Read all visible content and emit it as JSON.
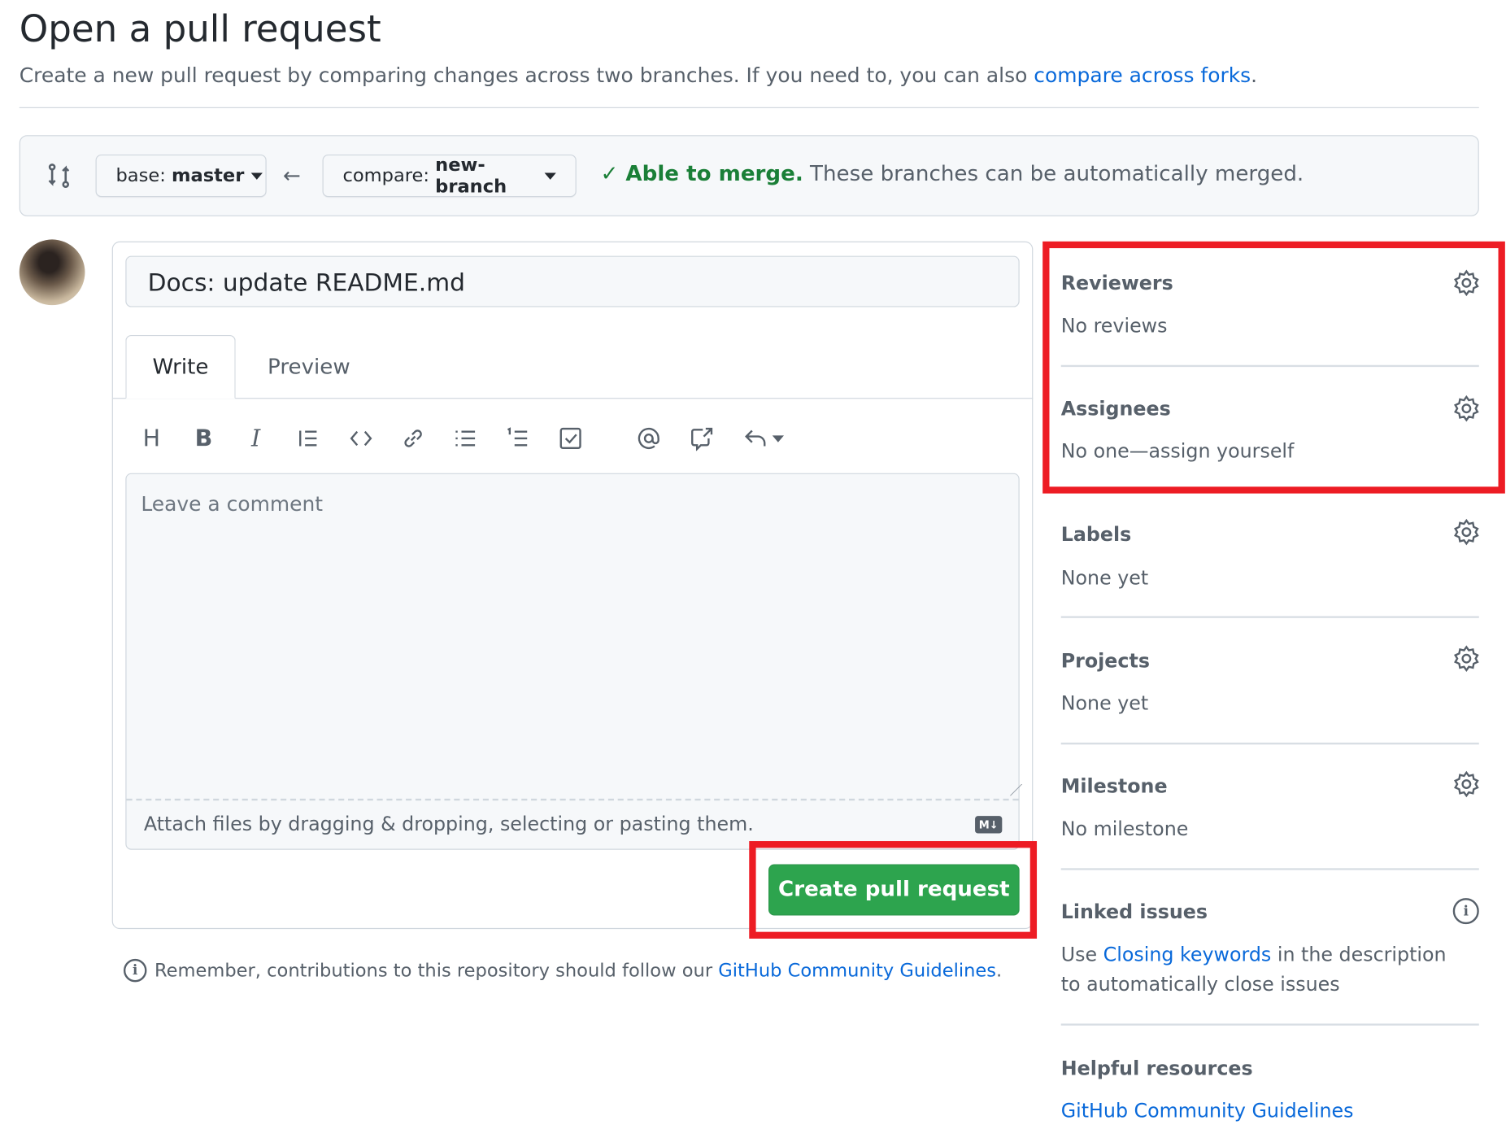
{
  "page": {
    "title": "Open a pull request",
    "subtitle": "Create a new pull request by comparing changes across two branches. If you need to, you can also ",
    "subtitle_link": "compare across forks",
    "subtitle_end": "."
  },
  "range": {
    "base_label": "base:",
    "base_value": "master",
    "compare_label": "compare:",
    "compare_value": "new-branch",
    "merge_status": "Able to merge.",
    "merge_message": " These branches can be automatically merged."
  },
  "form": {
    "title_value": "Docs: update README.md",
    "tabs": [
      {
        "label": "Write",
        "active": true
      },
      {
        "label": "Preview",
        "active": false
      }
    ],
    "toolbar": [
      "heading-icon",
      "bold-icon",
      "italic-icon",
      "quote-icon",
      "code-icon",
      "link-icon",
      "bulleted-list-icon",
      "numbered-list-icon",
      "task-list-icon",
      "mention-icon",
      "reference-icon",
      "reply-icon"
    ],
    "comment_placeholder": "Leave a comment",
    "attach_text": "Attach files by dragging & dropping, selecting or pasting them.",
    "markdown_badge": "M↓",
    "submit_label": "Create pull request"
  },
  "footer": {
    "remember_text": "Remember, contributions to this repository should follow our ",
    "remember_link": "GitHub Community Guidelines",
    "remember_end": "."
  },
  "sidebar": {
    "reviewers": {
      "title": "Reviewers",
      "value": "No reviews"
    },
    "assignees": {
      "title": "Assignees",
      "value": "No one—assign yourself"
    },
    "labels": {
      "title": "Labels",
      "value": "None yet"
    },
    "projects": {
      "title": "Projects",
      "value": "None yet"
    },
    "milestone": {
      "title": "Milestone",
      "value": "No milestone"
    },
    "linked": {
      "title": "Linked issues",
      "pre": "Use ",
      "link": "Closing keywords",
      "post": " in the description to automatically close issues"
    },
    "helpful": {
      "title": "Helpful resources",
      "link": "GitHub Community Guidelines"
    }
  },
  "colors": {
    "accent": "#0969da",
    "success": "#1a7f37",
    "button": "#2da44e",
    "highlight": "#ed1c24"
  }
}
